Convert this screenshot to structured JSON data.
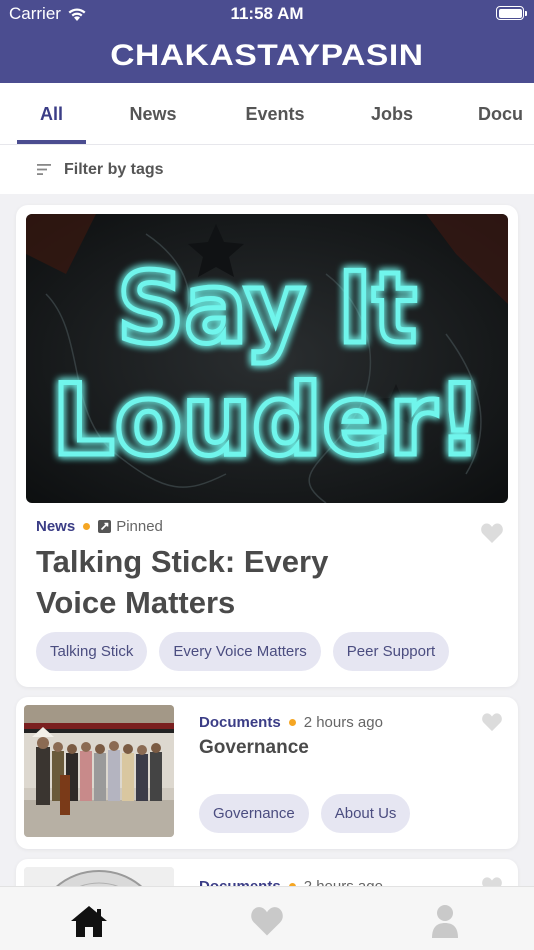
{
  "status_bar": {
    "carrier": "Carrier",
    "time": "11:58 AM"
  },
  "header": {
    "title": "CHAKASTAYPASIN"
  },
  "tabs": [
    {
      "label": "All",
      "active": true
    },
    {
      "label": "News"
    },
    {
      "label": "Events"
    },
    {
      "label": "Jobs"
    },
    {
      "label": "Docu"
    }
  ],
  "filter": {
    "label": "Filter by tags",
    "icon": "filter-lines-icon"
  },
  "posts": [
    {
      "category": "News",
      "pinned_label": "Pinned",
      "title": "Talking Stick: Every Voice Matters",
      "image_text": [
        "Say It",
        "Louder!"
      ],
      "tags": [
        "Talking Stick",
        "Every Voice Matters",
        "Peer Support"
      ]
    },
    {
      "category": "Documents",
      "time": "2 hours ago",
      "title": "Governance",
      "tags": [
        "Governance",
        "About Us"
      ]
    },
    {
      "category": "Documents",
      "time": "2 hours ago"
    }
  ],
  "bottom_nav": [
    {
      "icon": "home-icon",
      "active": true
    },
    {
      "icon": "heart-icon"
    },
    {
      "icon": "profile-icon"
    }
  ],
  "colors": {
    "brand": "#4b4d90",
    "accent_dot": "#f5a623",
    "tag_bg": "#e6e6f2"
  }
}
